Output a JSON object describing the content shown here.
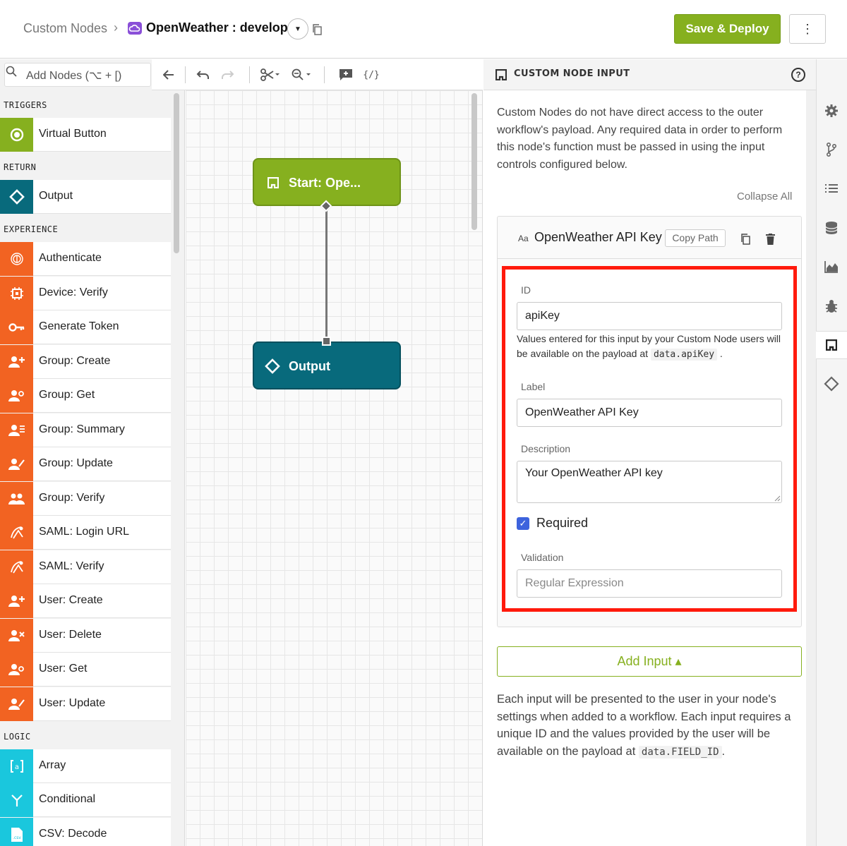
{
  "header": {
    "breadcrumb_root": "Custom Nodes",
    "breadcrumb_sep": "›",
    "node_name": "OpenWeather : develop",
    "save_deploy": "Save & Deploy",
    "more": "⋮"
  },
  "palette": {
    "search_placeholder": "Add Nodes (⌥ + [)",
    "sections": [
      {
        "label": "TRIGGERS"
      },
      {
        "label": "RETURN"
      },
      {
        "label": "EXPERIENCE"
      },
      {
        "label": "LOGIC"
      }
    ],
    "items": [
      {
        "label": "Virtual Button"
      },
      {
        "label": "Output"
      },
      {
        "label": "Authenticate"
      },
      {
        "label": "Device: Verify"
      },
      {
        "label": "Generate Token"
      },
      {
        "label": "Group: Create"
      },
      {
        "label": "Group: Get"
      },
      {
        "label": "Group: Summary"
      },
      {
        "label": "Group: Update"
      },
      {
        "label": "Group: Verify"
      },
      {
        "label": "SAML: Login URL"
      },
      {
        "label": "SAML: Verify"
      },
      {
        "label": "User: Create"
      },
      {
        "label": "User: Delete"
      },
      {
        "label": "User: Get"
      },
      {
        "label": "User: Update"
      },
      {
        "label": "Array"
      },
      {
        "label": "Conditional"
      },
      {
        "label": "CSV: Decode"
      }
    ]
  },
  "toolbar": {
    "code_label": "{/}"
  },
  "canvas": {
    "start_node": "Start: Ope...",
    "output_node": "Output"
  },
  "panel": {
    "title": "CUSTOM NODE INPUT",
    "help": "?",
    "intro": "Custom Nodes do not have direct access to the outer workflow's payload. Any required data in order to perform this node's function must be passed in using the input controls configured below.",
    "collapse_all": "Collapse All",
    "card": {
      "type_badge": "Aa",
      "title": "OpenWeather API Key",
      "copy_path": "Copy Path",
      "id_label": "ID",
      "id_value": "apiKey",
      "help_text": "Values entered for this input by your Custom Node users will be available on the payload at",
      "help_code": "data.apiKey",
      "help_end": ".",
      "label_label": "Label",
      "label_value": "OpenWeather API Key",
      "description_label": "Description",
      "description_value": "Your OpenWeather API key",
      "required_label": "Required",
      "required_checked": true,
      "validation_label": "Validation",
      "validation_placeholder": "Regular Expression"
    },
    "add_input": "Add Input ▴",
    "footer_text": "Each input will be presented to the user in your node's settings when added to a workflow. Each input requires a unique ID and the values provided by the user will be available on the payload at",
    "footer_code": "data.FIELD_ID",
    "footer_end": "."
  },
  "colors": {
    "brand_green": "#86b01f",
    "teal": "#086a7c",
    "orange": "#f26322",
    "cyan": "#1ac7dd",
    "highlight_red": "#ff1a0c",
    "checkbox_blue": "#3d63dd"
  }
}
